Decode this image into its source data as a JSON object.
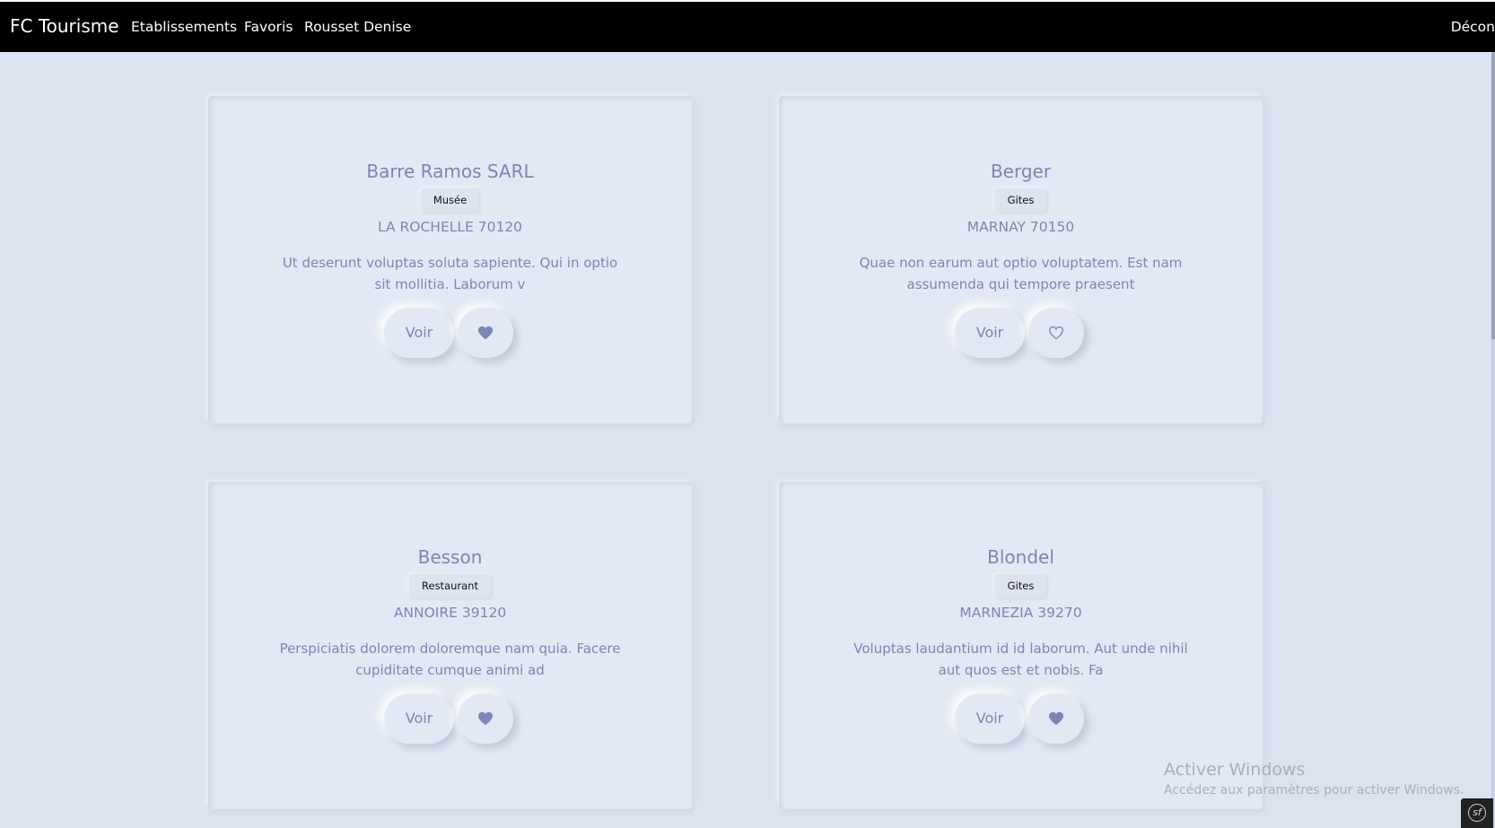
{
  "navbar": {
    "brand": "FC Tourisme",
    "links": [
      "Etablissements",
      "Favoris",
      "Rousset Denise"
    ],
    "logout": "Décon"
  },
  "cards": [
    {
      "title": "Barre Ramos SARL",
      "category": "Musée",
      "city": "LA ROCHELLE 70120",
      "desc_line1": "Ut deserunt voluptas soluta sapiente. Qui in optio",
      "desc_line2": "sit mollitia. Laborum v",
      "view_label": "Voir",
      "favorite": true
    },
    {
      "title": "Berger",
      "category": "Gites",
      "city": "MARNAY 70150",
      "desc_line1": "Quae non earum aut optio voluptatem. Est nam",
      "desc_line2": "assumenda qui tempore praesent",
      "view_label": "Voir",
      "favorite": false
    },
    {
      "title": "Besson",
      "category": "Restaurant",
      "city": "ANNOIRE 39120",
      "desc_line1": "Perspiciatis dolorem doloremque nam quia. Facere",
      "desc_line2": "cupiditate cumque animi ad",
      "view_label": "Voir",
      "favorite": true
    },
    {
      "title": "Blondel",
      "category": "Gites",
      "city": "MARNEZIA 39270",
      "desc_line1": "Voluptas laudantium id id laborum. Aut unde nihil",
      "desc_line2": "aut quos est et nobis. Fa",
      "view_label": "Voir",
      "favorite": true
    }
  ],
  "watermark": {
    "title": "Activer Windows",
    "subtitle": "Accédez aux paramètres pour activer Windows."
  },
  "symfony_toolbar": "sf",
  "colors": {
    "background": "#dbe3f1",
    "card": "#e3e9f4",
    "text_accent": "#7b85b6",
    "navbar": "#000000"
  }
}
